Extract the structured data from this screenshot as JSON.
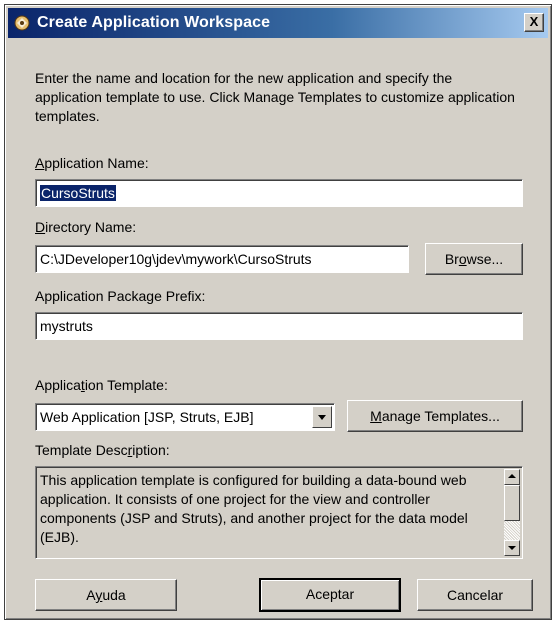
{
  "window": {
    "title": "Create Application Workspace",
    "close_glyph": "X",
    "icon": "jdeveloper-app-icon"
  },
  "intro_text": "Enter the name and location for the new application and specify the application template to use. Click Manage Templates to customize application templates.",
  "fields": {
    "app_name": {
      "label_mnemonic": "A",
      "label_rest": "pplication Name:",
      "value": "CursoStruts"
    },
    "dir_name": {
      "label_mnemonic": "D",
      "label_rest": "irectory Name:",
      "value": "C:\\JDeveloper10g\\jdev\\mywork\\CursoStruts"
    },
    "pkg_prefix": {
      "label": "Application Package Prefix:",
      "value": "mystruts"
    },
    "template": {
      "label_pre": "Applica",
      "label_mnemonic": "t",
      "label_post": "ion Template:",
      "value": "Web Application [JSP, Struts, EJB]"
    },
    "description": {
      "label_pre": "Template Desc",
      "label_mnemonic": "r",
      "label_post": "iption:",
      "text": "This application template is configured for building a data-bound web application. It consists of one project for the view and controller components (JSP and Struts), and another project for the data model (EJB)."
    }
  },
  "buttons": {
    "browse_pre": "Br",
    "browse_mnemonic": "o",
    "browse_post": "wse...",
    "manage_mnemonic": "M",
    "manage_rest": "anage Templates...",
    "help_pre": "A",
    "help_mnemonic": "y",
    "help_post": "uda",
    "ok": "Aceptar",
    "cancel": "Cancelar"
  },
  "colors": {
    "dialog_bg": "#d4d0c8",
    "titlebar_start": "#0a246a",
    "titlebar_end": "#a6caf0",
    "selection": "#0a246a"
  }
}
